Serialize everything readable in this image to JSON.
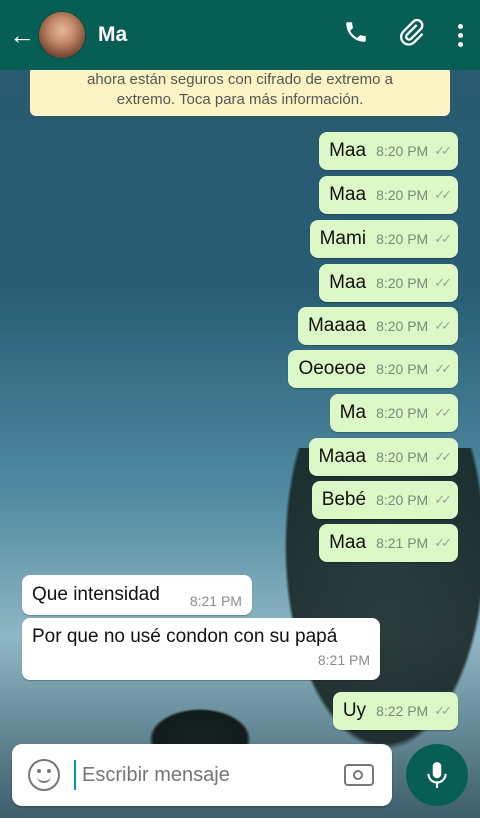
{
  "header": {
    "title": "Ma"
  },
  "notice": {
    "line1": "ahora están seguros con cifrado de extremo a",
    "line2": "extremo. Toca para más información."
  },
  "messages": [
    {
      "text": "Maa",
      "time": "8:20 PM"
    },
    {
      "text": "Maa",
      "time": "8:20 PM"
    },
    {
      "text": "Mami",
      "time": "8:20 PM"
    },
    {
      "text": "Maa",
      "time": "8:20 PM"
    },
    {
      "text": "Maaaa",
      "time": "8:20 PM"
    },
    {
      "text": "Oeoeoe",
      "time": "8:20 PM"
    },
    {
      "text": "Ma",
      "time": "8:20 PM"
    },
    {
      "text": "Maaa",
      "time": "8:20 PM"
    },
    {
      "text": "Bebé",
      "time": "8:20 PM"
    },
    {
      "text": "Maa",
      "time": "8:21 PM"
    },
    {
      "text": "Que intensidad",
      "time": "8:21 PM"
    },
    {
      "text": "Por que no usé condon con su papá",
      "time": "8:21 PM"
    },
    {
      "text": "Uy",
      "time": "8:22 PM"
    }
  ],
  "input": {
    "placeholder": "Escribir mensaje"
  },
  "icons": {
    "back": "arrow-left-icon",
    "call": "phone-icon",
    "attach": "paperclip-icon",
    "menu": "more-vert-icon",
    "emoji": "emoji-icon",
    "camera": "camera-icon",
    "mic": "mic-icon",
    "read": "double-check-icon"
  },
  "colors": {
    "header": "#075e54",
    "outgoing": "#dcf8c6",
    "incoming": "#ffffff",
    "notice": "#fdf4c5"
  }
}
